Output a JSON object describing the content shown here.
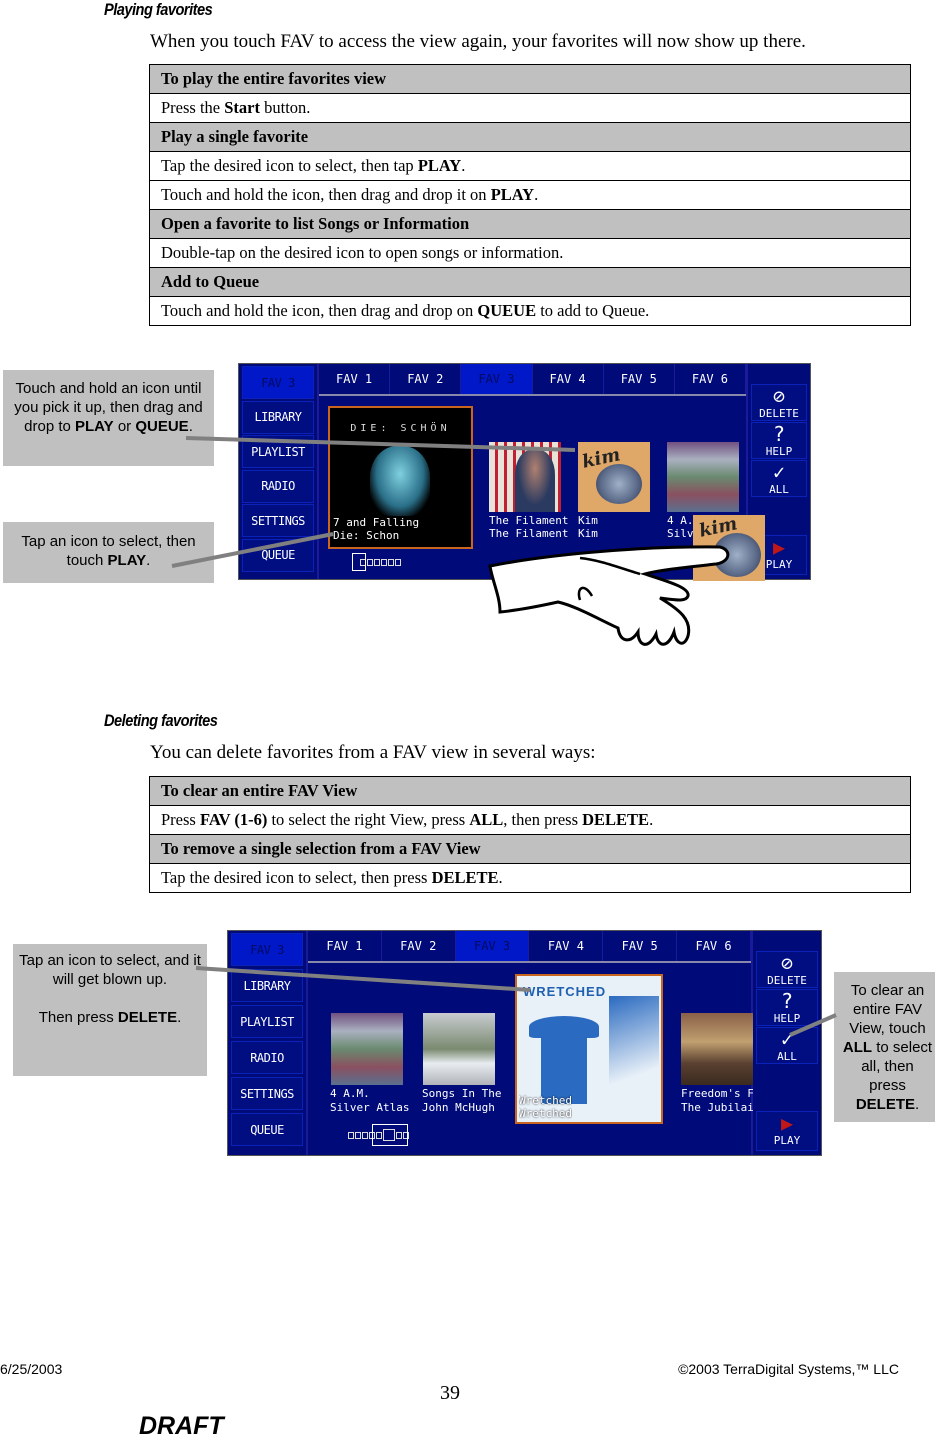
{
  "section1": {
    "heading": "Playing favorites",
    "intro": "When you touch FAV to access the view again, your favorites will now show up there.",
    "rows": [
      {
        "type": "header",
        "parts": [
          {
            "t": "To play the entire favorites view",
            "b": false
          }
        ]
      },
      {
        "type": "body",
        "parts": [
          {
            "t": "Press the ",
            "b": false
          },
          {
            "t": "Start",
            "b": true
          },
          {
            "t": " button.",
            "b": false
          }
        ]
      },
      {
        "type": "header",
        "parts": [
          {
            "t": "Play a single favorite",
            "b": false
          }
        ]
      },
      {
        "type": "body",
        "parts": [
          {
            "t": "Tap the desired icon to select, then tap ",
            "b": false
          },
          {
            "t": "PLAY",
            "b": true
          },
          {
            "t": ".",
            "b": false
          }
        ]
      },
      {
        "type": "body",
        "parts": [
          {
            "t": "Touch and hold the icon, then drag and drop it on ",
            "b": false
          },
          {
            "t": "PLAY",
            "b": true
          },
          {
            "t": ".",
            "b": false
          }
        ]
      },
      {
        "type": "header",
        "parts": [
          {
            "t": "Open a favorite to list Songs or Information",
            "b": false
          }
        ]
      },
      {
        "type": "body",
        "parts": [
          {
            "t": "Double-tap on the desired icon to open songs or information.",
            "b": false
          }
        ]
      },
      {
        "type": "header",
        "parts": [
          {
            "t": "Add to Queue",
            "b": false
          }
        ]
      },
      {
        "type": "body",
        "parts": [
          {
            "t": "Touch and hold the icon, then drag and drop on ",
            "b": false
          },
          {
            "t": "QUEUE",
            "b": true
          },
          {
            "t": " to add to Queue.",
            "b": false
          }
        ]
      }
    ]
  },
  "callouts1": {
    "drag": {
      "pre": "Touch and hold an icon until you pick it up, then drag and drop to ",
      "b1": "PLAY",
      "mid": " or ",
      "b2": "QUEUE",
      "post": "."
    },
    "tap": {
      "pre": "Tap an icon to select, then touch ",
      "b1": "PLAY",
      "post": "."
    }
  },
  "jukebox": {
    "side_active": "FAV 3",
    "side_items": [
      "LIBRARY",
      "PLAYLIST",
      "RADIO",
      "SETTINGS",
      "QUEUE"
    ],
    "tabs": [
      "FAV 1",
      "FAV 2",
      "FAV 3",
      "FAV 4",
      "FAV 5",
      "FAV 6"
    ],
    "active_tab": "FAV 3",
    "actions": {
      "delete": {
        "icon": "⊘",
        "label": "DELETE"
      },
      "help": {
        "icon": "?",
        "label": "HELP"
      },
      "all": {
        "icon": "✓",
        "label": "ALL"
      },
      "play": {
        "icon": "▶",
        "label": "PLAY"
      }
    },
    "accent_selected": "#c8651e",
    "bg": "#000a78"
  },
  "screen1": {
    "selected": {
      "cover_text": "DIE: SCHÖN",
      "line1": "7 and Falling",
      "line2": "Die: Schon"
    },
    "albums": [
      {
        "line1": "The Filament",
        "line2": "The Filament"
      },
      {
        "line1": "Kim",
        "line2": "Kim"
      },
      {
        "line1": "4 A.M.",
        "line2": "Silver Atlas"
      }
    ],
    "dragged_album": "Kim"
  },
  "section2": {
    "heading": "Deleting favorites",
    "intro": "You can delete favorites from a FAV view in several ways:",
    "rows": [
      {
        "type": "header",
        "parts": [
          {
            "t": "To clear an entire FAV View",
            "b": false
          }
        ]
      },
      {
        "type": "body",
        "parts": [
          {
            "t": "Press ",
            "b": false
          },
          {
            "t": "FAV (1-6)",
            "b": true
          },
          {
            "t": " to select the right View, press ",
            "b": false
          },
          {
            "t": "ALL",
            "b": true
          },
          {
            "t": ", then press ",
            "b": false
          },
          {
            "t": "DELETE",
            "b": true
          },
          {
            "t": ".",
            "b": false
          }
        ]
      },
      {
        "type": "header",
        "parts": [
          {
            "t": "To remove a single selection from a FAV View",
            "b": false
          }
        ]
      },
      {
        "type": "body",
        "parts": [
          {
            "t": "Tap the desired icon to select, then press ",
            "b": false
          },
          {
            "t": "DELETE",
            "b": true
          },
          {
            "t": ".",
            "b": false
          }
        ]
      }
    ]
  },
  "callouts2": {
    "tap": {
      "line1": "Tap an icon to select, and it will get blown up.",
      "pre2": "Then press ",
      "b1": "DELETE",
      "post": "."
    },
    "clear": {
      "pre": "To clear an entire FAV View, touch ",
      "b1": "ALL",
      "mid": " to select all, then press ",
      "b2": "DELETE",
      "post": "."
    }
  },
  "screen2": {
    "albums": [
      {
        "line1": "4 A.M.",
        "line2": "Silver Atlas"
      },
      {
        "line1": "Songs In The",
        "line2": "John McHugh"
      },
      {
        "line1": "Freedom's Fr",
        "line2": "The Jubilaire:"
      }
    ],
    "selected": {
      "cover_text": "WRETCHED",
      "line1": "Wretched",
      "line2": "Wretched"
    }
  },
  "footer": {
    "date": "6/25/2003",
    "copyright": "©2003 TerraDigital Systems,™ LLC",
    "page_number": "39",
    "draft": "DRAFT"
  }
}
